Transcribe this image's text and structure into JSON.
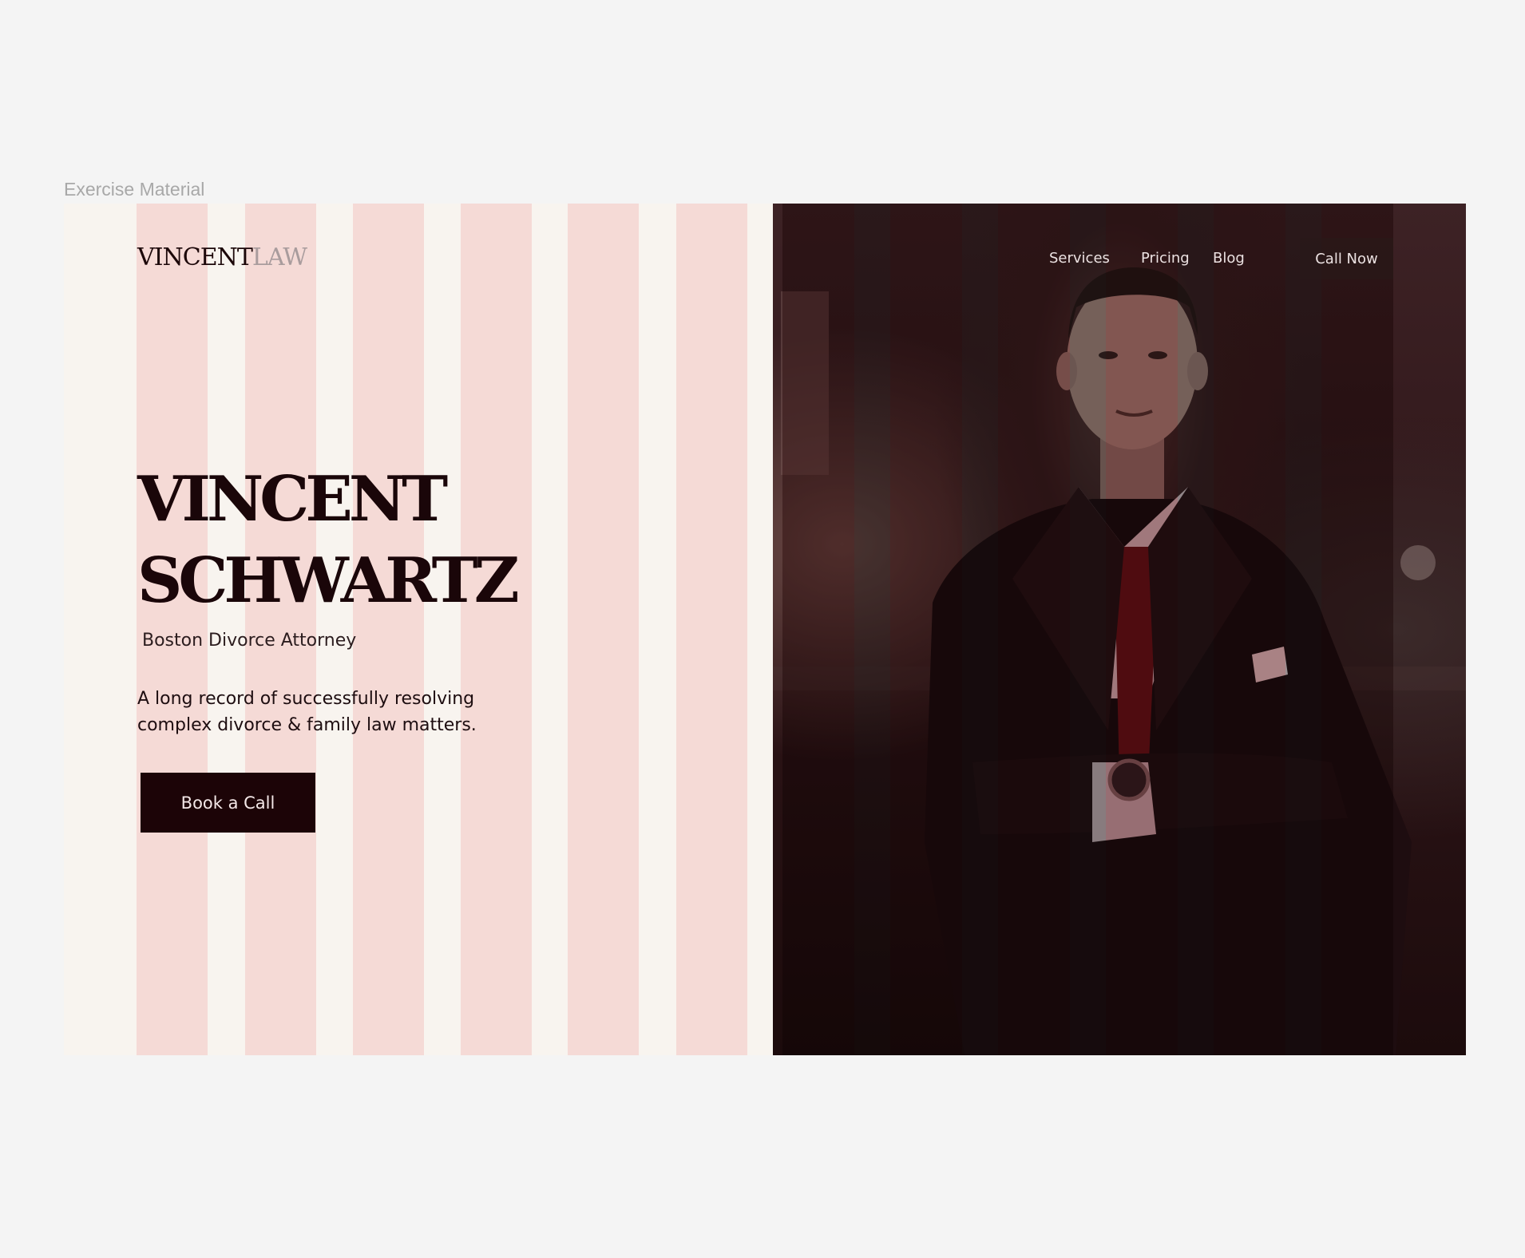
{
  "frame_label": "Exercise Material",
  "logo": {
    "primary": "VINCENT",
    "secondary": "LAW"
  },
  "hero": {
    "title_line1": "VINCENT",
    "title_line2": "SCHWARTZ",
    "subtitle": "Boston Divorce Attorney",
    "description": "A long record of successfully resolving complex divorce & family law matters.",
    "cta_label": "Book a Call"
  },
  "nav": {
    "items": [
      "Services",
      "Pricing",
      "Blog"
    ],
    "call_label": "Call Now"
  },
  "colors": {
    "page_background": "#f4f4f4",
    "panel_background": "#f8f4ef",
    "column_overlay": "#f5dad6",
    "brand_dark": "#1c0407",
    "logo_muted": "#a99c9d",
    "photo_overlay": "#5f0c10"
  },
  "icons": []
}
